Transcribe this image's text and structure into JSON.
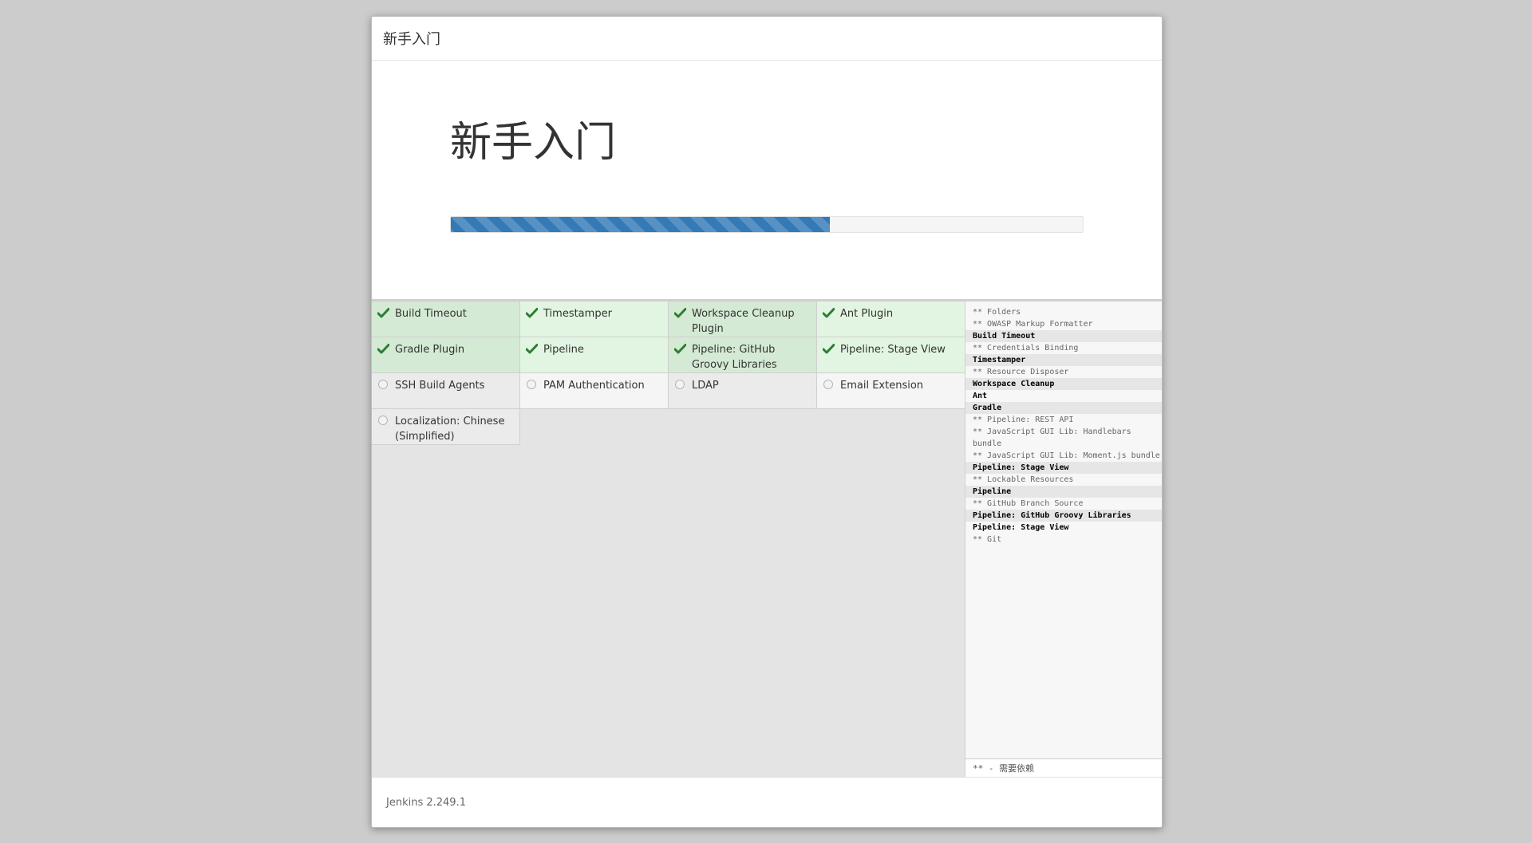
{
  "dialog": {
    "header_title": "新手入门",
    "hero_title": "新手入门",
    "progress_percent": 60,
    "footer_version": "Jenkins 2.249.1"
  },
  "colors": {
    "progress": "#337ab7",
    "checkmark": "#2e7d32",
    "installed_bg": "#e2f5e2",
    "pending_bg": "#f5f5f5"
  },
  "plugins": [
    {
      "label": "Build Timeout",
      "status": "installed",
      "icon": "checkmark-icon"
    },
    {
      "label": "Timestamper",
      "status": "installed",
      "icon": "checkmark-icon"
    },
    {
      "label": "Workspace Cleanup Plugin",
      "status": "installed",
      "icon": "checkmark-icon"
    },
    {
      "label": "Ant Plugin",
      "status": "installed",
      "icon": "checkmark-icon"
    },
    {
      "label": "Gradle Plugin",
      "status": "installed",
      "icon": "checkmark-icon"
    },
    {
      "label": "Pipeline",
      "status": "installed",
      "icon": "checkmark-icon"
    },
    {
      "label": "Pipeline: GitHub Groovy Libraries",
      "status": "installed",
      "icon": "checkmark-icon"
    },
    {
      "label": "Pipeline: Stage View",
      "status": "installed",
      "icon": "checkmark-icon"
    },
    {
      "label": "SSH Build Agents",
      "status": "pending",
      "icon": "pending-circle-icon"
    },
    {
      "label": "PAM Authentication",
      "status": "pending",
      "icon": "pending-circle-icon"
    },
    {
      "label": "LDAP",
      "status": "pending",
      "icon": "pending-circle-icon"
    },
    {
      "label": "Email Extension",
      "status": "pending",
      "icon": "pending-circle-icon"
    },
    {
      "label": "Localization: Chinese (Simplified)",
      "status": "pending",
      "icon": "pending-circle-icon"
    }
  ],
  "log": {
    "lines": [
      {
        "text": "** Folders",
        "kind": "dep"
      },
      {
        "text": "** OWASP Markup Formatter",
        "kind": "dep"
      },
      {
        "text": "Build Timeout",
        "kind": "main"
      },
      {
        "text": "** Credentials Binding",
        "kind": "dep"
      },
      {
        "text": "Timestamper",
        "kind": "main"
      },
      {
        "text": "** Resource Disposer",
        "kind": "dep"
      },
      {
        "text": "Workspace Cleanup",
        "kind": "main"
      },
      {
        "text": "Ant",
        "kind": "main"
      },
      {
        "text": "Gradle",
        "kind": "main"
      },
      {
        "text": "** Pipeline: REST API",
        "kind": "dep"
      },
      {
        "text": "** JavaScript GUI Lib: Handlebars bundle",
        "kind": "dep"
      },
      {
        "text": "** JavaScript GUI Lib: Moment.js bundle",
        "kind": "dep"
      },
      {
        "text": "Pipeline: Stage View",
        "kind": "main"
      },
      {
        "text": "** Lockable Resources",
        "kind": "dep"
      },
      {
        "text": "Pipeline",
        "kind": "main"
      },
      {
        "text": "** GitHub Branch Source",
        "kind": "dep"
      },
      {
        "text": "Pipeline: GitHub Groovy Libraries",
        "kind": "main"
      },
      {
        "text": "Pipeline: Stage View",
        "kind": "main"
      },
      {
        "text": "** Git",
        "kind": "dep"
      }
    ],
    "footer_note": "** - 需要依赖"
  }
}
